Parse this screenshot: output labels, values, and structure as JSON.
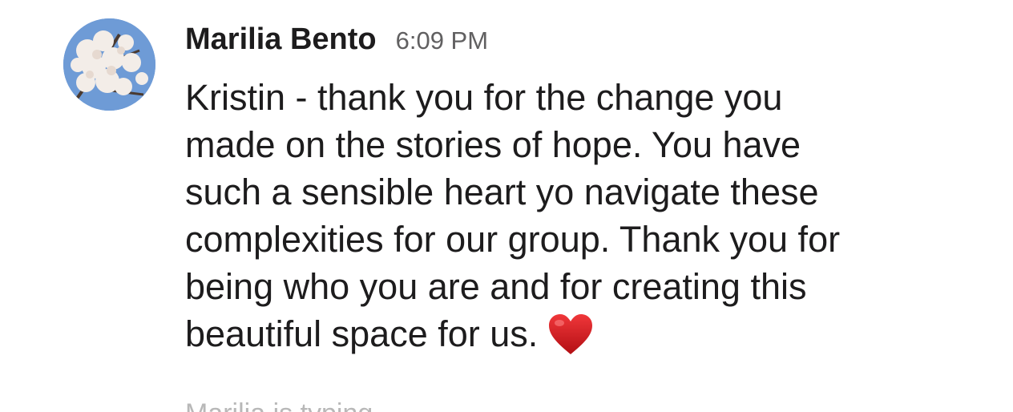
{
  "message": {
    "author": "Marilia Bento",
    "timestamp": "6:09 PM",
    "lines": [
      "Kristin - thank you for the change you",
      "made on the stories of hope. You have",
      "such a sensible heart yo navigate these",
      "complexities for our group. Thank you for",
      "being who you are and for creating this",
      "beautiful space for us."
    ],
    "emoji": "red-heart-icon",
    "avatar_icon": "cherry-blossom-avatar"
  },
  "next_message_preview": "Marilia is typing",
  "colors": {
    "text": "#1d1c1d",
    "timestamp": "#616061",
    "heart": "#d4151c",
    "faded": "#b8b8b8"
  }
}
